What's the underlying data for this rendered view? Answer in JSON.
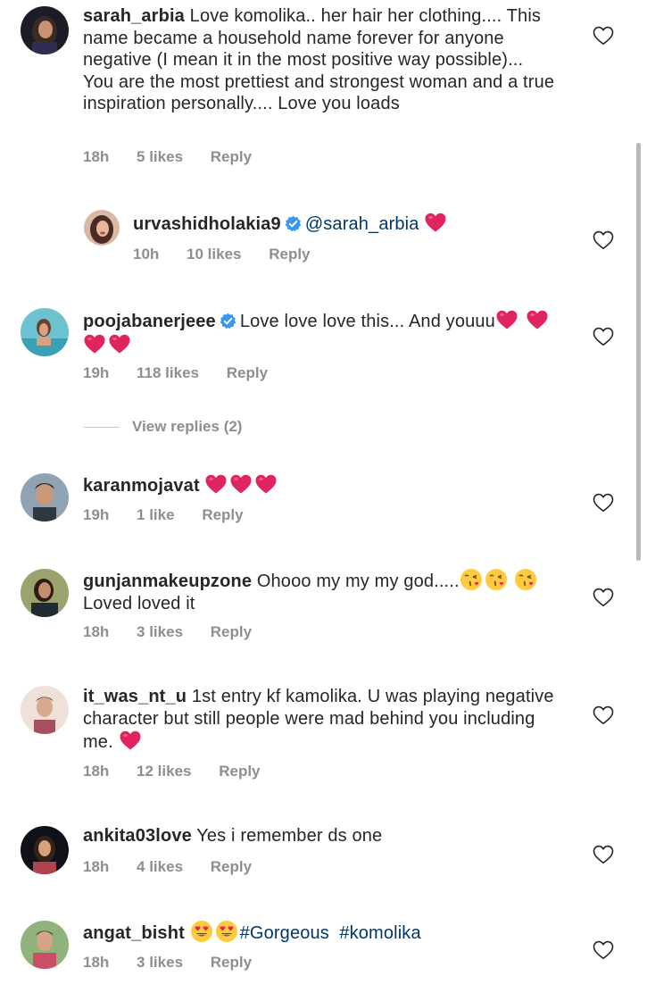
{
  "comments": {
    "c1": {
      "username": "sarah_arbia",
      "text": "Love komolika.. her hair her clothing.... This name became a household name forever for anyone negative (I mean it in the most positive way possible)... You are the most prettiest and strongest woman and a true inspiration personally.... Love you loads",
      "time": "18h",
      "likes": "5 likes",
      "reply": "Reply"
    },
    "c2": {
      "username": "urvashidholakia9",
      "mention": "@sarah_arbia",
      "time": "10h",
      "likes": "10 likes",
      "reply": "Reply"
    },
    "c3": {
      "username": "poojabanerjeee",
      "text": "Love love love this... And youuu",
      "time": "19h",
      "likes": "118 likes",
      "reply": "Reply"
    },
    "c4": {
      "username": "karanmojavat",
      "time": "19h",
      "likes": "1 like",
      "reply": "Reply"
    },
    "c5": {
      "username": "gunjanmakeupzone",
      "text": "Ohooo my my my god.....",
      "text2": "Loved loved it",
      "time": "18h",
      "likes": "3 likes",
      "reply": "Reply"
    },
    "c6": {
      "username": "it_was_nt_u",
      "text": "1st entry kf kamolika. U was playing negative character but still people were mad behind you including me.",
      "time": "18h",
      "likes": "12 likes",
      "reply": "Reply"
    },
    "c7": {
      "username": "ankita03love",
      "text": "Yes i remember ds one",
      "time": "18h",
      "likes": "4 likes",
      "reply": "Reply"
    },
    "c8": {
      "username": "angat_bisht",
      "tag1": "#Gorgeous",
      "tag2": "#komolika",
      "time": "18h",
      "likes": "3 likes",
      "reply": "Reply"
    }
  },
  "view_replies": "View replies (2)",
  "icons": {
    "like": "heart-outline-icon",
    "verified": "verified-badge-icon",
    "red_heart": "red-heart-emoji",
    "kiss": "face-blowing-kiss-emoji",
    "heart_eyes": "heart-eyes-emoji"
  },
  "colors": {
    "text": "#262626",
    "meta": "#8e8e8e",
    "link": "#00376b",
    "verified": "#3897f0",
    "heart": "#e0245e"
  }
}
